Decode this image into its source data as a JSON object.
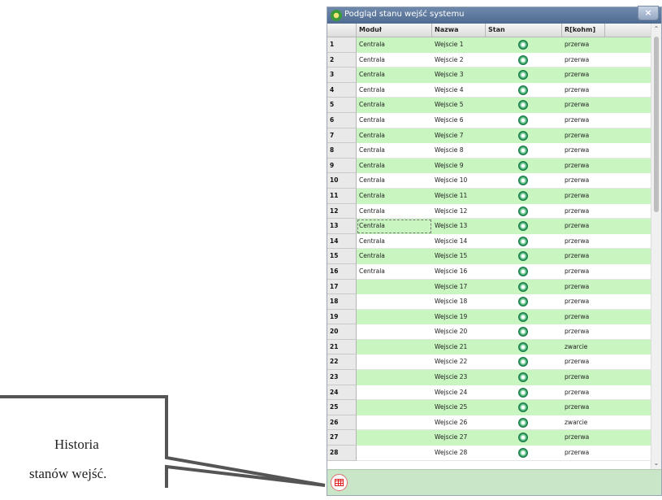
{
  "window": {
    "title": "Podgląd stanu wejść systemu",
    "close_label": "×"
  },
  "columns": [
    "Moduł",
    "Nazwa",
    "Stan",
    "R[kohm]"
  ],
  "rows": [
    {
      "num": "1",
      "modul": "Centrala",
      "nazwa": "Wejscie 1",
      "stan": "ok-icon",
      "r": "przerwa"
    },
    {
      "num": "2",
      "modul": "Centrala",
      "nazwa": "Wejscie 2",
      "stan": "ok-icon",
      "r": "przerwa"
    },
    {
      "num": "3",
      "modul": "Centrala",
      "nazwa": "Wejscie 3",
      "stan": "ok-icon",
      "r": "przerwa"
    },
    {
      "num": "4",
      "modul": "Centrala",
      "nazwa": "Wejscie 4",
      "stan": "ok-icon",
      "r": "przerwa"
    },
    {
      "num": "5",
      "modul": "Centrala",
      "nazwa": "Wejscie 5",
      "stan": "ok-icon",
      "r": "przerwa"
    },
    {
      "num": "6",
      "modul": "Centrala",
      "nazwa": "Wejscie 6",
      "stan": "ok-icon",
      "r": "przerwa"
    },
    {
      "num": "7",
      "modul": "Centrala",
      "nazwa": "Wejscie 7",
      "stan": "ok-icon",
      "r": "przerwa"
    },
    {
      "num": "8",
      "modul": "Centrala",
      "nazwa": "Wejscie 8",
      "stan": "ok-icon",
      "r": "przerwa"
    },
    {
      "num": "9",
      "modul": "Centrala",
      "nazwa": "Wejscie 9",
      "stan": "ok-icon",
      "r": "przerwa"
    },
    {
      "num": "10",
      "modul": "Centrala",
      "nazwa": "Wejscie 10",
      "stan": "ok-icon",
      "r": "przerwa"
    },
    {
      "num": "11",
      "modul": "Centrala",
      "nazwa": "Wejscie 11",
      "stan": "ok-icon",
      "r": "przerwa"
    },
    {
      "num": "12",
      "modul": "Centrala",
      "nazwa": "Wejscie 12",
      "stan": "ok-icon",
      "r": "przerwa"
    },
    {
      "num": "13",
      "modul": "Centrala",
      "nazwa": "Wejscie 13",
      "stan": "ok-icon",
      "r": "przerwa"
    },
    {
      "num": "14",
      "modul": "Centrala",
      "nazwa": "Wejscie 14",
      "stan": "ok-icon",
      "r": "przerwa"
    },
    {
      "num": "15",
      "modul": "Centrala",
      "nazwa": "Wejscie 15",
      "stan": "ok-icon",
      "r": "przerwa"
    },
    {
      "num": "16",
      "modul": "Centrala",
      "nazwa": "Wejscie 16",
      "stan": "ok-icon",
      "r": "przerwa"
    },
    {
      "num": "17",
      "modul": "",
      "nazwa": "Wejscie 17",
      "stan": "ok-icon",
      "r": "przerwa"
    },
    {
      "num": "18",
      "modul": "",
      "nazwa": "Wejscie 18",
      "stan": "ok-icon",
      "r": "przerwa"
    },
    {
      "num": "19",
      "modul": "",
      "nazwa": "Wejscie 19",
      "stan": "ok-icon",
      "r": "przerwa"
    },
    {
      "num": "20",
      "modul": "",
      "nazwa": "Wejscie 20",
      "stan": "ok-icon",
      "r": "przerwa"
    },
    {
      "num": "21",
      "modul": "",
      "nazwa": "Wejscie 21",
      "stan": "ok-icon",
      "r": "zwarcie"
    },
    {
      "num": "22",
      "modul": "",
      "nazwa": "Wejscie 22",
      "stan": "ok-icon",
      "r": "przerwa"
    },
    {
      "num": "23",
      "modul": "",
      "nazwa": "Wejscie 23",
      "stan": "ok-icon",
      "r": "przerwa"
    },
    {
      "num": "24",
      "modul": "",
      "nazwa": "Wejscie 24",
      "stan": "ok-icon",
      "r": "przerwa"
    },
    {
      "num": "25",
      "modul": "",
      "nazwa": "Wejscie 25",
      "stan": "ok-icon",
      "r": "przerwa"
    },
    {
      "num": "26",
      "modul": "",
      "nazwa": "Wejscie 26",
      "stan": "ok-icon",
      "r": "zwarcie"
    },
    {
      "num": "27",
      "modul": "",
      "nazwa": "Wejscie 27",
      "stan": "ok-icon",
      "r": "przerwa"
    },
    {
      "num": "28",
      "modul": "",
      "nazwa": "Wejscie 28",
      "stan": "ok-icon",
      "r": "przerwa"
    }
  ],
  "focused_row": "13",
  "colors": {
    "row_alt": "#c8f5c0",
    "titlebar": "#5a759b",
    "statusbar": "#c9e6c8",
    "status_led": "#2f9b60"
  },
  "statusbar": {
    "history_button_icon": "table-icon"
  },
  "callout": {
    "line1": "Historia",
    "line2": "stanów wejść."
  }
}
